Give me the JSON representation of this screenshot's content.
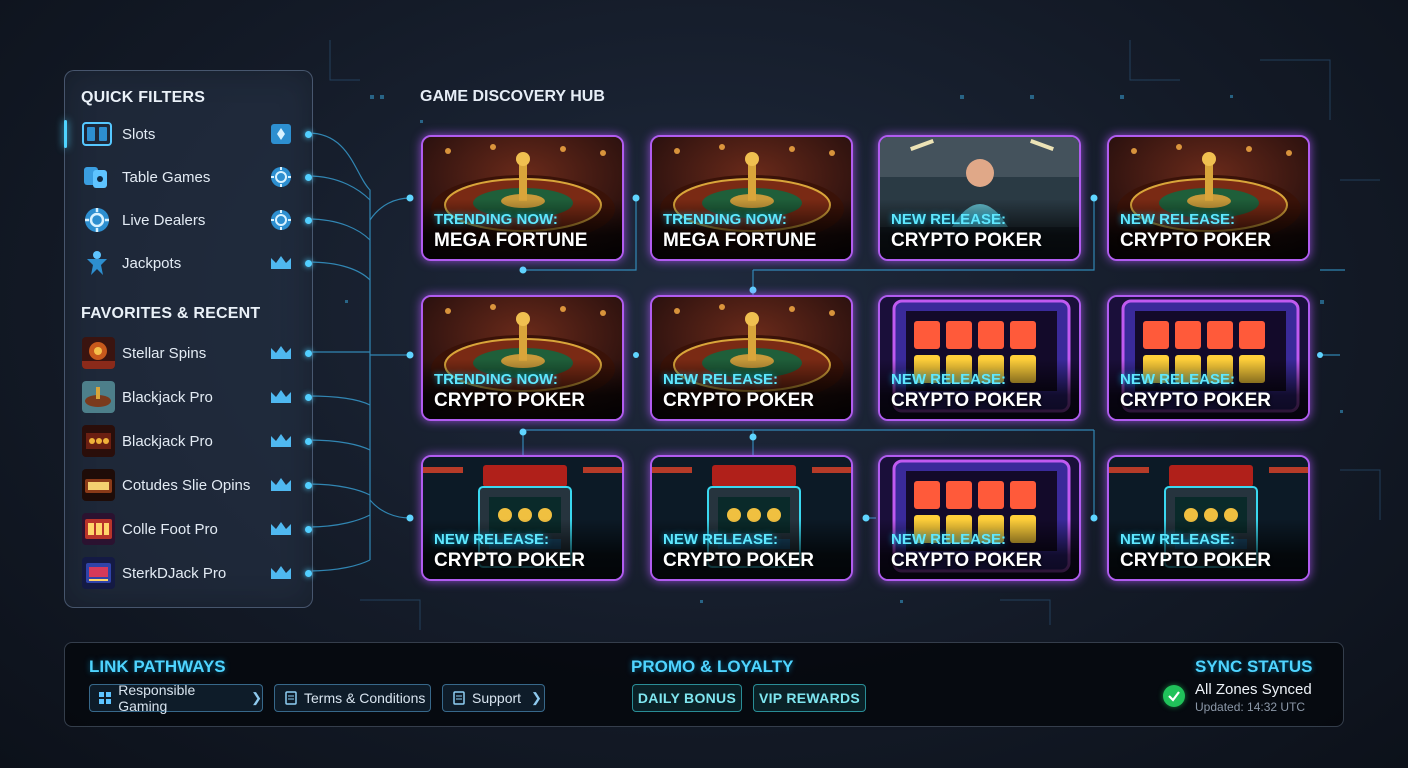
{
  "sidebar": {
    "quick_filters_title": "QUICK FILTERS",
    "filters": [
      {
        "label": "Slots",
        "icon": "slot-reels-icon",
        "right_icon": "card-suit-icon",
        "active": true
      },
      {
        "label": "Table Games",
        "icon": "table-games-icon",
        "right_icon": "poker-chip-icon",
        "active": false
      },
      {
        "label": "Live Dealers",
        "icon": "live-dealer-chip-icon",
        "right_icon": "poker-chip-icon",
        "active": false
      },
      {
        "label": "Jackpots",
        "icon": "jackpot-figure-icon",
        "right_icon": "crown-icon",
        "active": false
      }
    ],
    "favorites_title": "FAVORITES & RECENT",
    "favorites": [
      {
        "label": "Stellar Spins",
        "thumb": "slot-thumbnail"
      },
      {
        "label": "Blackjack Pro",
        "thumb": "roulette-thumbnail"
      },
      {
        "label": "Blackjack Pro",
        "thumb": "slot-thumbnail"
      },
      {
        "label": "Cotudes Slie Opins",
        "thumb": "slot-thumbnail"
      },
      {
        "label": "Colle Foot Pro",
        "thumb": "slot-thumbnail"
      },
      {
        "label": "SterkDJack Pro",
        "thumb": "slot-thumbnail"
      }
    ]
  },
  "hub": {
    "title": "GAME DISCOVERY HUB",
    "cards": [
      {
        "tag": "TRENDING NOW:",
        "name": "MEGA FORTUNE",
        "art": "roulette"
      },
      {
        "tag": "TRENDING NOW:",
        "name": "MEGA FORTUNE",
        "art": "roulette"
      },
      {
        "tag": "NEW RELEASE:",
        "name": "CRYPTO POKER",
        "art": "live-dealer"
      },
      {
        "tag": "NEW RELEASE:",
        "name": "CRYPTO POKER",
        "art": "roulette"
      },
      {
        "tag": "TRENDING NOW:",
        "name": "CRYPTO POKER",
        "art": "roulette"
      },
      {
        "tag": "NEW RELEASE:",
        "name": "CRYPTO POKER",
        "art": "roulette"
      },
      {
        "tag": "NEW RELEASE:",
        "name": "CRYPTO POKER",
        "art": "slot"
      },
      {
        "tag": "NEW RELEASE:",
        "name": "CRYPTO POKER",
        "art": "slot"
      },
      {
        "tag": "NEW RELEASE:",
        "name": "CRYPTO POKER",
        "art": "slot-cabinet"
      },
      {
        "tag": "NEW RELEASE:",
        "name": "CRYPTO POKER",
        "art": "slot-cabinet"
      },
      {
        "tag": "NEW RELEASE:",
        "name": "CRYPTO POKER",
        "art": "slot"
      },
      {
        "tag": "NEW RELEASE:",
        "name": "CRYPTO POKER",
        "art": "slot-cabinet"
      }
    ]
  },
  "footer": {
    "link_pathways_title": "LINK PATHWAYS",
    "links": [
      {
        "label": "Responsible Gaming",
        "icon": "grid-icon"
      },
      {
        "label": "Terms & Conditions",
        "icon": "document-icon"
      },
      {
        "label": "Support",
        "icon": "support-doc-icon"
      }
    ],
    "promo_title": "PROMO & LOYALTY",
    "promos": [
      "DAILY BONUS",
      "VIP REWARDS"
    ],
    "sync_title": "SYNC STATUS",
    "sync_status": "All Zones Synced",
    "sync_updated": "Updated: 14:32 UTC"
  },
  "colors": {
    "accent_cyan": "#4fd4ff",
    "card_border_purple": "#b15cf0",
    "sync_green": "#20c25a"
  }
}
